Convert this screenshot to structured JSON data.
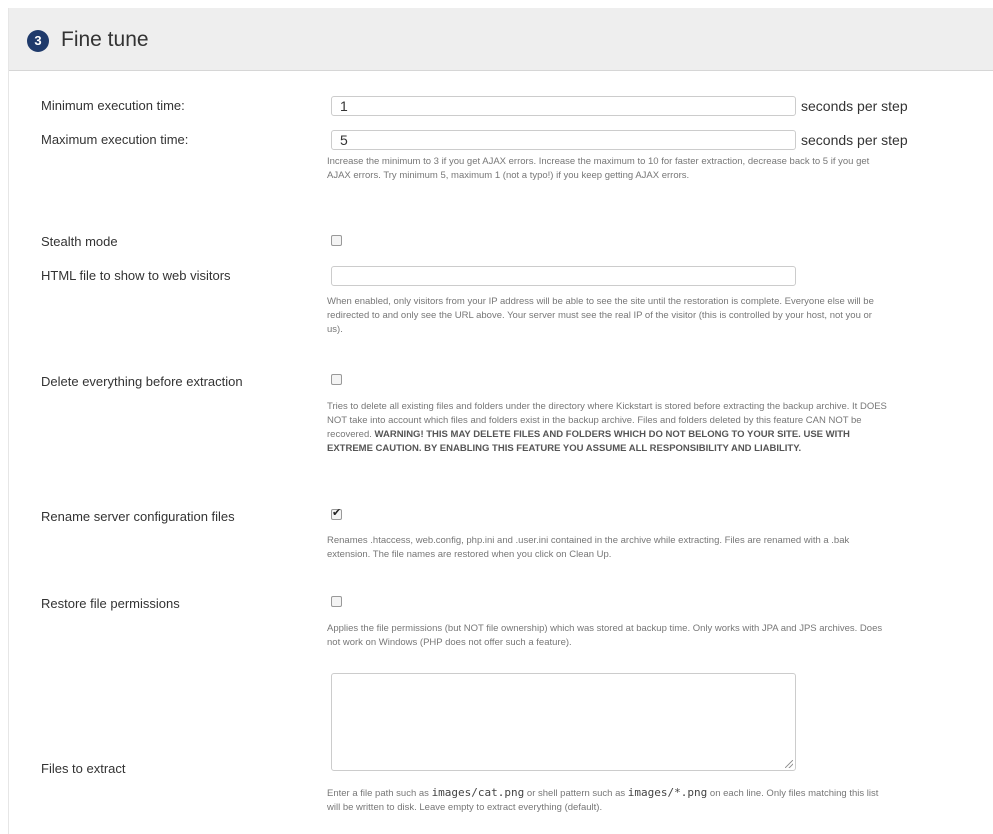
{
  "header": {
    "step_number": "3",
    "title": "Fine tune"
  },
  "min_exec": {
    "label": "Minimum execution time:",
    "value": "1",
    "suffix": "seconds per step"
  },
  "max_exec": {
    "label": "Maximum execution time:",
    "value": "5",
    "suffix": "seconds per step",
    "help": "Increase the minimum to 3 if you get AJAX errors. Increase the maximum to 10 for faster extraction, decrease back to 5 if you get AJAX errors. Try minimum 5, maximum 1 (not a typo!) if you keep getting AJAX errors."
  },
  "stealth": {
    "label": "Stealth mode",
    "checked": false
  },
  "html_file": {
    "label": "HTML file to show to web visitors",
    "value": "",
    "help": "When enabled, only visitors from your IP address will be able to see the site until the restoration is complete. Everyone else will be redirected to and only see the URL above. Your server must see the real IP of the visitor (this is controlled by your host, not you or us)."
  },
  "delete_everything": {
    "label": "Delete everything before extraction",
    "checked": false,
    "help": "Tries to delete all existing files and folders under the directory where Kickstart is stored before extracting the backup archive. It DOES NOT take into account which files and folders exist in the backup archive. Files and folders deleted by this feature CAN NOT be recovered.",
    "warning": "WARNING! THIS MAY DELETE FILES AND FOLDERS WHICH DO NOT BELONG TO YOUR SITE. USE WITH EXTREME CAUTION. BY ENABLING THIS FEATURE YOU ASSUME ALL RESPONSIBILITY AND LIABILITY."
  },
  "rename_config": {
    "label": "Rename server configuration files",
    "checked": true,
    "help": "Renames .htaccess, web.config, php.ini and .user.ini contained in the archive while extracting. Files are renamed with a .bak extension. The file names are restored when you click on Clean Up."
  },
  "restore_perms": {
    "label": "Restore file permissions",
    "checked": false,
    "help": "Applies the file permissions (but NOT file ownership) which was stored at backup time. Only works with JPA and JPS archives. Does not work on Windows (PHP does not offer such a feature)."
  },
  "files_to_extract": {
    "label": "Files to extract",
    "value": "",
    "help_1": "Enter a file path such as",
    "code_1": "images/cat.png",
    "help_2": "or shell pattern such as",
    "code_2": "images/*.png",
    "help_3": "on each line. Only files matching this list will be written to disk. Leave empty to extract everything (default)."
  },
  "icons": {
    "check": "check-icon"
  }
}
